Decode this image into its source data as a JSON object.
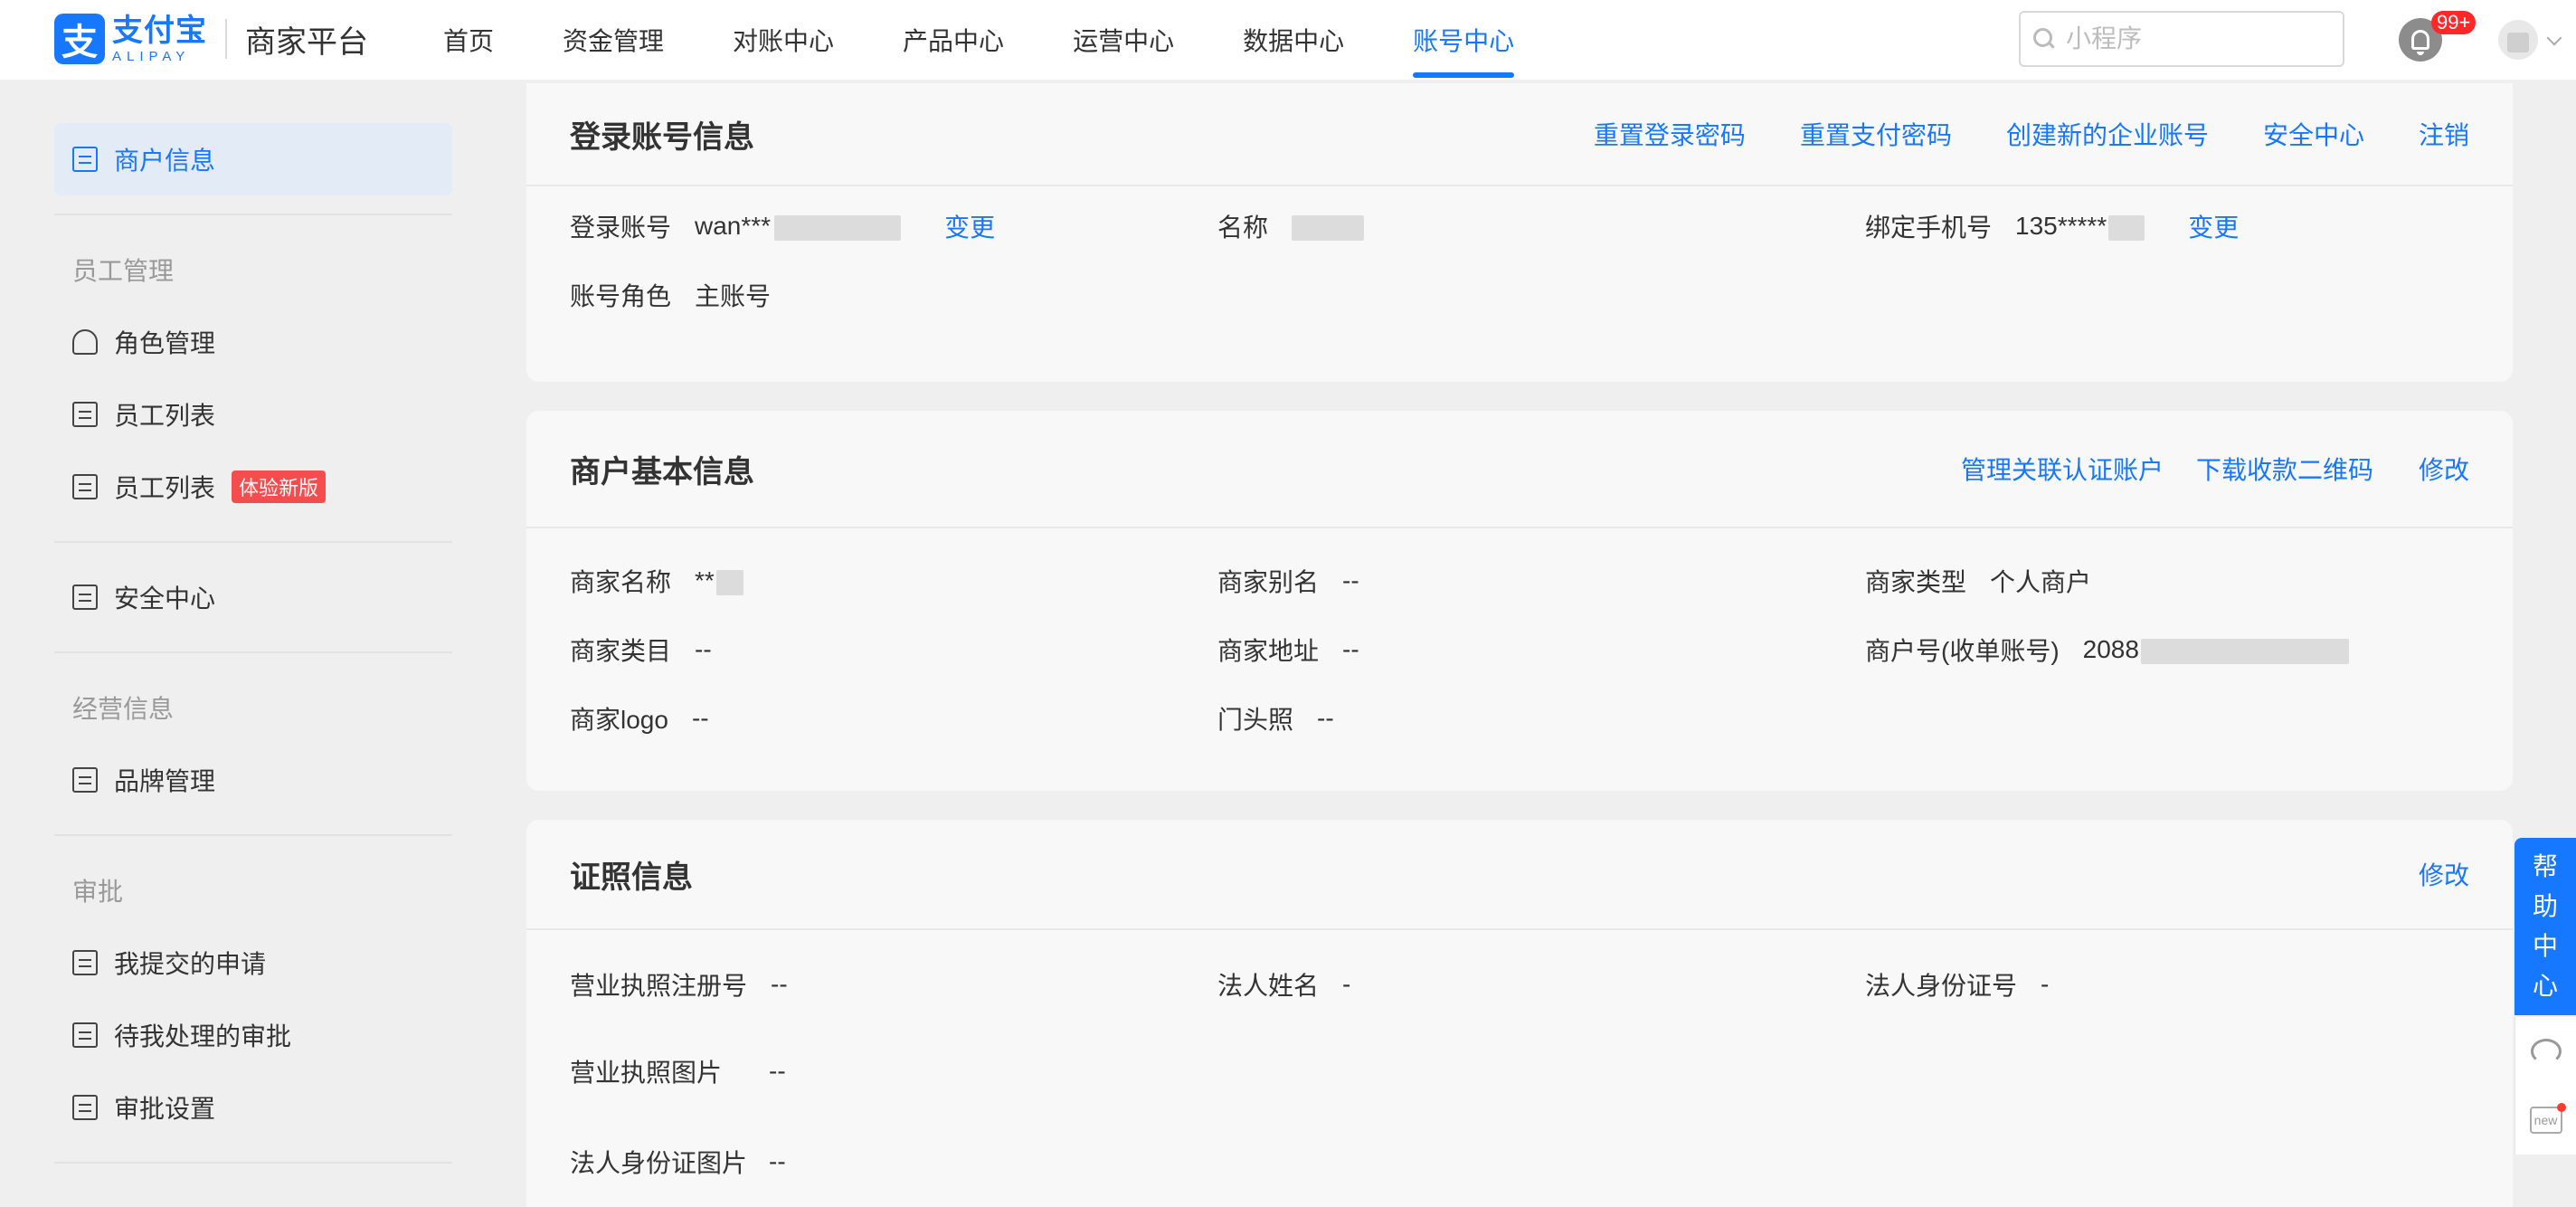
{
  "brand": {
    "logo_glyph": "支",
    "name_cn": "支付宝",
    "name_en": "ALIPAY",
    "product": "商家平台"
  },
  "nav": {
    "items": [
      {
        "label": "首页",
        "active": false
      },
      {
        "label": "资金管理",
        "active": false
      },
      {
        "label": "对账中心",
        "active": false
      },
      {
        "label": "产品中心",
        "active": false
      },
      {
        "label": "运营中心",
        "active": false
      },
      {
        "label": "数据中心",
        "active": false
      },
      {
        "label": "账号中心",
        "active": true
      }
    ]
  },
  "header": {
    "search_placeholder": "小程序",
    "notification_count": "99+"
  },
  "sidebar": {
    "merchant_info": "商户信息",
    "section_staff": "员工管理",
    "role_mgmt": "角色管理",
    "staff_list": "员工列表",
    "staff_list_new": "员工列表",
    "new_tag": "体验新版",
    "security": "安全中心",
    "section_business": "经营信息",
    "brand_mgmt": "品牌管理",
    "section_approval": "审批",
    "my_requests": "我提交的申请",
    "pending_approval": "待我处理的审批",
    "approval_settings": "审批设置"
  },
  "login_card": {
    "title": "登录账号信息",
    "actions": [
      "重置登录密码",
      "重置支付密码",
      "创建新的企业账号",
      "安全中心",
      "注销"
    ],
    "account_label": "登录账号",
    "account_value": "wan***",
    "account_change": "变更",
    "name_label": "名称",
    "phone_label": "绑定手机号",
    "phone_value": "135*****",
    "phone_change": "变更",
    "role_label": "账号角色",
    "role_value": "主账号"
  },
  "basic_card": {
    "title": "商户基本信息",
    "actions": [
      "管理关联认证账户",
      "下载收款二维码",
      "修改"
    ],
    "merchant_name_label": "商家名称",
    "merchant_name_value": "**",
    "alias_label": "商家别名",
    "alias_value": "--",
    "type_label": "商家类型",
    "type_value": "个人商户",
    "category_label": "商家类目",
    "category_value": "--",
    "address_label": "商家地址",
    "address_value": "--",
    "pid_label": "商户号(收单账号)",
    "pid_value": "2088",
    "logo_label": "商家logo",
    "logo_value": "--",
    "storefront_label": "门头照",
    "storefront_value": "--"
  },
  "license_card": {
    "title": "证照信息",
    "action": "修改",
    "license_no_label": "营业执照注册号",
    "license_no_value": "--",
    "legal_name_label": "法人姓名",
    "legal_name_value": "-",
    "legal_id_label": "法人身份证号",
    "legal_id_value": "-",
    "license_img_label": "营业执照图片",
    "license_img_value": "--",
    "id_img_label": "法人身份证图片",
    "id_img_value": "--"
  },
  "help": {
    "chars": [
      "帮",
      "助",
      "中",
      "心"
    ],
    "new_label": "new"
  },
  "colors": {
    "accent": "#1677ff",
    "badge": "#ff2727",
    "tag": "#f54d4d",
    "background": "#efefef"
  }
}
